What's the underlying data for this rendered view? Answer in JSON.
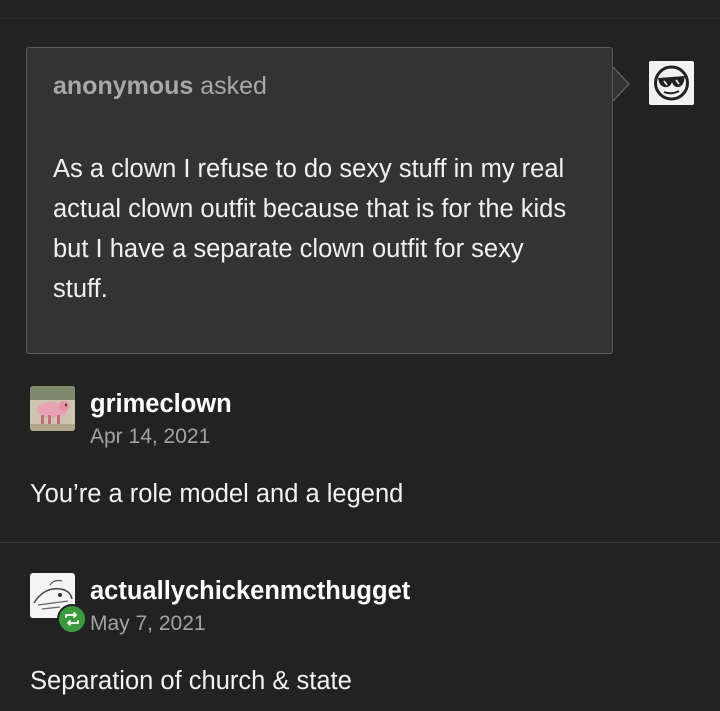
{
  "ask": {
    "asker": "anonymous",
    "verb": "asked",
    "text": "As a clown I refuse to do sexy stuff in my real actual clown outfit because that is for the kids but I have a separate clown outfit for sexy stuff.",
    "avatar_icon": "sunglasses-face-icon"
  },
  "replies": [
    {
      "username": "grimeclown",
      "date": "Apr 14, 2021",
      "text": "You’re a role model and a legend",
      "avatar_icon": "pink-creature-avatar"
    },
    {
      "username": "actuallychickenmcthugget",
      "date": "May 7, 2021",
      "text": "Separation of church & state",
      "avatar_icon": "sketch-avatar",
      "badge_icon": "reblog-icon"
    }
  ],
  "colors": {
    "background": "#222222",
    "ask_box": "#333333",
    "ask_border": "#5c5c5c",
    "reblog_badge": "#3c9a3e",
    "muted_text": "#a3a3a3"
  }
}
